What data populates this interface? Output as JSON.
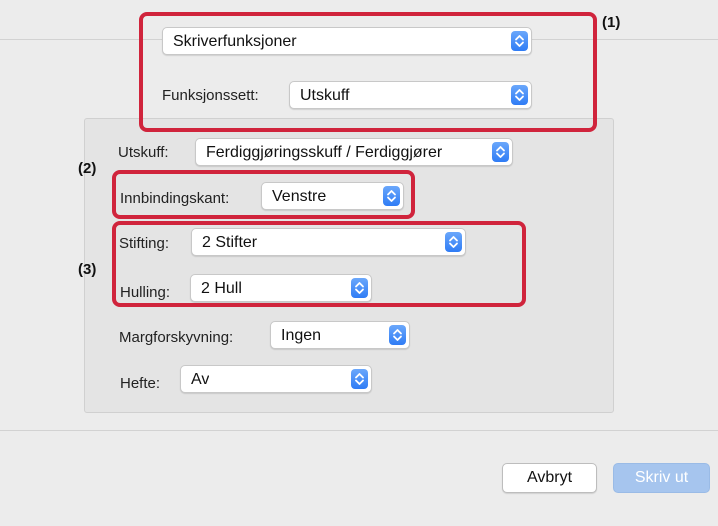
{
  "top_section": {
    "category_select": {
      "value": "Skriverfunksjoner"
    },
    "preset_label": "Funksjonssett:",
    "preset_select": {
      "value": "Utskuff"
    }
  },
  "finishing_panel": {
    "output_label": "Utskuff:",
    "output_select": {
      "value": "Ferdiggjøringsskuff / Ferdiggjører"
    },
    "binding_edge_label": "Innbindingskant:",
    "binding_edge_select": {
      "value": "Venstre"
    },
    "staple_label": "Stifting:",
    "staple_select": {
      "value": "2 Stifter"
    },
    "punch_label": "Hulling:",
    "punch_select": {
      "value": "2 Hull"
    },
    "margin_shift_label": "Margforskyvning:",
    "margin_shift_select": {
      "value": "Ingen"
    },
    "booklet_label": "Hefte:",
    "booklet_select": {
      "value": "Av"
    }
  },
  "callouts": {
    "one": "(1)",
    "two": "(2)",
    "three": "(3)"
  },
  "buttons": {
    "cancel": "Avbryt",
    "print": "Skriv ut"
  },
  "colors": {
    "highlight": "#d0243c",
    "accent": "#2f7cf5",
    "print_button": "#a6c5ee"
  }
}
